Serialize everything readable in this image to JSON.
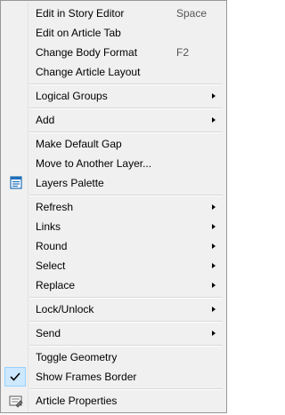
{
  "menu": {
    "items": [
      {
        "label": "Edit in Story Editor",
        "shortcut": "Space"
      },
      {
        "label": "Edit on Article Tab"
      },
      {
        "label": "Change Body Format",
        "shortcut": "F2"
      },
      {
        "label": "Change Article Layout"
      },
      {
        "label": "Logical Groups",
        "submenu": true
      },
      {
        "label": "Add",
        "submenu": true
      },
      {
        "label": "Make Default Gap"
      },
      {
        "label": "Move to Another Layer..."
      },
      {
        "label": "Layers Palette",
        "icon": "layers-palette-icon"
      },
      {
        "label": "Refresh",
        "submenu": true
      },
      {
        "label": "Links",
        "submenu": true
      },
      {
        "label": "Round",
        "submenu": true
      },
      {
        "label": "Select",
        "submenu": true
      },
      {
        "label": "Replace",
        "submenu": true
      },
      {
        "label": "Lock/Unlock",
        "submenu": true
      },
      {
        "label": "Send",
        "submenu": true
      },
      {
        "label": "Toggle Geometry"
      },
      {
        "label": "Show Frames Border",
        "checked": true
      },
      {
        "label": "Article Properties",
        "icon": "article-properties-icon"
      }
    ]
  },
  "colors": {
    "background": "#f0f0f0",
    "border": "#979797",
    "check_highlight": "#cde8ff",
    "icon_blue": "#1e6fb8"
  }
}
